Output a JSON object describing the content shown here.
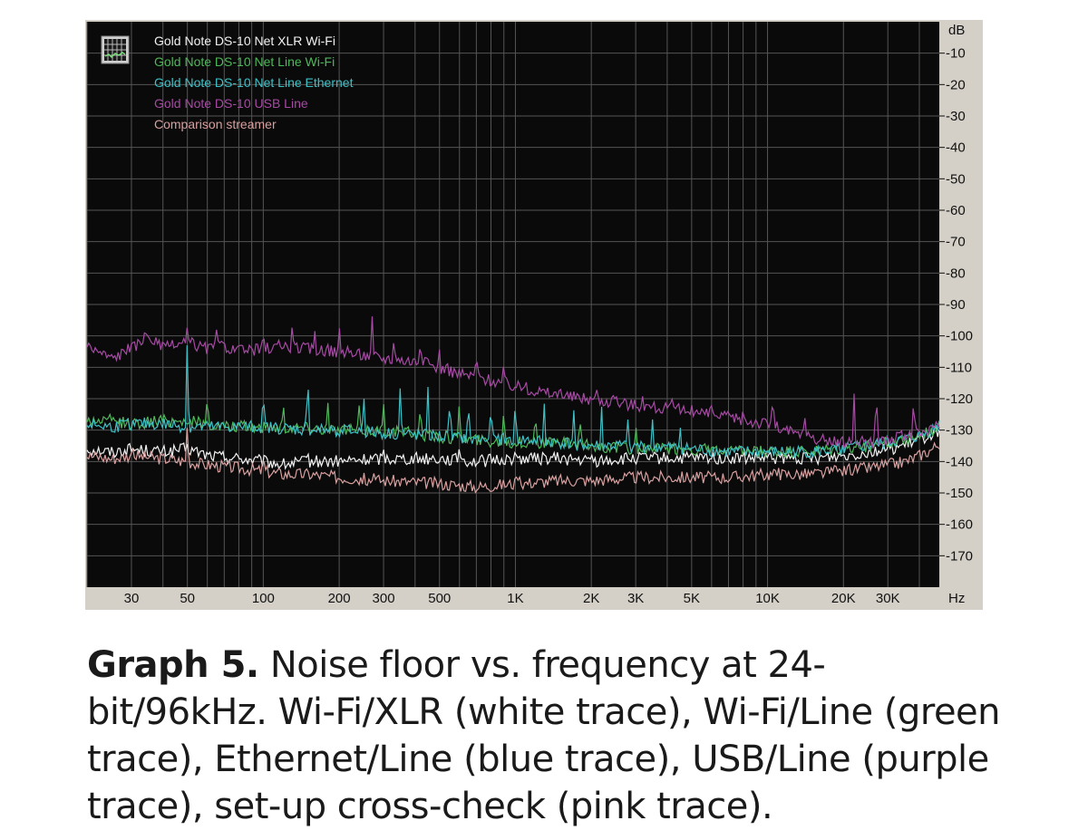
{
  "chart_data": {
    "type": "line",
    "x_scale": "log",
    "xlim": [
      20,
      48000
    ],
    "ylim": [
      -180,
      0
    ],
    "y_unit": "dB",
    "x_unit": "Hz",
    "x_ticks": [
      {
        "v": 30,
        "label": "30"
      },
      {
        "v": 50,
        "label": "50"
      },
      {
        "v": 100,
        "label": "100"
      },
      {
        "v": 200,
        "label": "200"
      },
      {
        "v": 300,
        "label": "300"
      },
      {
        "v": 500,
        "label": "500"
      },
      {
        "v": 1000,
        "label": "1K"
      },
      {
        "v": 2000,
        "label": "2K"
      },
      {
        "v": 3000,
        "label": "3K"
      },
      {
        "v": 5000,
        "label": "5K"
      },
      {
        "v": 10000,
        "label": "10K"
      },
      {
        "v": 20000,
        "label": "20K"
      },
      {
        "v": 30000,
        "label": "30K"
      }
    ],
    "y_ticks": [
      {
        "v": -10,
        "label": "-10"
      },
      {
        "v": -20,
        "label": "-20"
      },
      {
        "v": -30,
        "label": "-30"
      },
      {
        "v": -40,
        "label": "-40"
      },
      {
        "v": -50,
        "label": "-50"
      },
      {
        "v": -60,
        "label": "-60"
      },
      {
        "v": -70,
        "label": "-70"
      },
      {
        "v": -80,
        "label": "-80"
      },
      {
        "v": -90,
        "label": "-90"
      },
      {
        "v": -100,
        "label": "-100"
      },
      {
        "v": -110,
        "label": "-110"
      },
      {
        "v": -120,
        "label": "-120"
      },
      {
        "v": -130,
        "label": "-130"
      },
      {
        "v": -140,
        "label": "-140"
      },
      {
        "v": -150,
        "label": "-150"
      },
      {
        "v": -160,
        "label": "-160"
      },
      {
        "v": -170,
        "label": "-170"
      }
    ],
    "grid": true,
    "legend_position": "top-left",
    "colors": {
      "background": "#0a0a0a",
      "grid": "#555555",
      "axis_panel": "#d4d0c8"
    },
    "series": [
      {
        "name": "Gold Note DS-10 Net XLR Wi-Fi",
        "color": "#f2f2f2",
        "points": [
          [
            20,
            -136
          ],
          [
            25,
            -137
          ],
          [
            30,
            -136
          ],
          [
            40,
            -137
          ],
          [
            50,
            -136
          ],
          [
            60,
            -138
          ],
          [
            80,
            -139
          ],
          [
            100,
            -140
          ],
          [
            120,
            -141
          ],
          [
            150,
            -140
          ],
          [
            200,
            -140
          ],
          [
            300,
            -139
          ],
          [
            500,
            -139
          ],
          [
            700,
            -140
          ],
          [
            1000,
            -139
          ],
          [
            1500,
            -139
          ],
          [
            2000,
            -140
          ],
          [
            3000,
            -139
          ],
          [
            5000,
            -139
          ],
          [
            7000,
            -139
          ],
          [
            10000,
            -139
          ],
          [
            15000,
            -139
          ],
          [
            20000,
            -138
          ],
          [
            25000,
            -137
          ],
          [
            30000,
            -136
          ],
          [
            35000,
            -135
          ],
          [
            40000,
            -133
          ],
          [
            45000,
            -131
          ],
          [
            48000,
            -130
          ]
        ],
        "spikes": [
          [
            150,
            -136
          ],
          [
            300,
            -136
          ],
          [
            600,
            -135
          ],
          [
            1000,
            -136
          ],
          [
            2000,
            -137
          ],
          [
            5000,
            -137
          ]
        ]
      },
      {
        "name": "Gold Note DS-10 Net Line Wi-Fi",
        "color": "#4fb85a",
        "points": [
          [
            20,
            -127
          ],
          [
            25,
            -127
          ],
          [
            30,
            -128
          ],
          [
            40,
            -127
          ],
          [
            50,
            -127
          ],
          [
            60,
            -128
          ],
          [
            70,
            -129
          ],
          [
            100,
            -129
          ],
          [
            150,
            -129
          ],
          [
            200,
            -130
          ],
          [
            300,
            -130
          ],
          [
            500,
            -132
          ],
          [
            700,
            -133
          ],
          [
            1000,
            -134
          ],
          [
            1500,
            -134
          ],
          [
            2000,
            -135
          ],
          [
            3000,
            -136
          ],
          [
            5000,
            -136
          ],
          [
            7000,
            -137
          ],
          [
            10000,
            -137
          ],
          [
            15000,
            -137
          ],
          [
            20000,
            -136
          ],
          [
            25000,
            -135
          ],
          [
            30000,
            -134
          ],
          [
            40000,
            -132
          ],
          [
            45000,
            -130
          ],
          [
            48000,
            -128
          ]
        ],
        "spikes": [
          [
            60,
            -117
          ],
          [
            120,
            -120
          ],
          [
            180,
            -119
          ],
          [
            240,
            -122
          ],
          [
            300,
            -121
          ],
          [
            420,
            -120
          ],
          [
            600,
            -119
          ],
          [
            900,
            -121
          ],
          [
            1200,
            -122
          ],
          [
            1800,
            -124
          ],
          [
            3000,
            -127
          ]
        ]
      },
      {
        "name": "Gold Note DS-10 Net Line Ethernet",
        "color": "#3ec0c6",
        "points": [
          [
            20,
            -128
          ],
          [
            25,
            -129
          ],
          [
            30,
            -128
          ],
          [
            40,
            -128
          ],
          [
            50,
            -129
          ],
          [
            60,
            -129
          ],
          [
            70,
            -129
          ],
          [
            100,
            -129
          ],
          [
            150,
            -130
          ],
          [
            200,
            -130
          ],
          [
            300,
            -131
          ],
          [
            500,
            -132
          ],
          [
            700,
            -133
          ],
          [
            1000,
            -133
          ],
          [
            1500,
            -134
          ],
          [
            2000,
            -135
          ],
          [
            3000,
            -135
          ],
          [
            5000,
            -136
          ],
          [
            7000,
            -137
          ],
          [
            10000,
            -137
          ],
          [
            15000,
            -137
          ],
          [
            20000,
            -136
          ],
          [
            25000,
            -135
          ],
          [
            30000,
            -134
          ],
          [
            40000,
            -132
          ],
          [
            45000,
            -130
          ],
          [
            48000,
            -128
          ]
        ],
        "spikes": [
          [
            50,
            -95
          ],
          [
            100,
            -115
          ],
          [
            150,
            -108
          ],
          [
            250,
            -116
          ],
          [
            350,
            -112
          ],
          [
            450,
            -116
          ],
          [
            550,
            -117
          ],
          [
            650,
            -118
          ],
          [
            800,
            -119
          ],
          [
            1000,
            -118
          ],
          [
            1300,
            -120
          ],
          [
            1700,
            -121
          ],
          [
            2200,
            -122
          ],
          [
            2800,
            -125
          ],
          [
            3500,
            -126
          ],
          [
            4500,
            -128
          ]
        ]
      },
      {
        "name": "Gold Note DS-10 USB Line",
        "color": "#a64aa4",
        "points": [
          [
            20,
            -103
          ],
          [
            25,
            -107
          ],
          [
            30,
            -104
          ],
          [
            35,
            -100
          ],
          [
            40,
            -104
          ],
          [
            50,
            -102
          ],
          [
            60,
            -104
          ],
          [
            70,
            -103
          ],
          [
            80,
            -105
          ],
          [
            100,
            -104
          ],
          [
            120,
            -103
          ],
          [
            150,
            -104
          ],
          [
            200,
            -105
          ],
          [
            250,
            -106
          ],
          [
            300,
            -107
          ],
          [
            400,
            -108
          ],
          [
            500,
            -110
          ],
          [
            600,
            -112
          ],
          [
            800,
            -114
          ],
          [
            1000,
            -116
          ],
          [
            1500,
            -119
          ],
          [
            2000,
            -120
          ],
          [
            3000,
            -122
          ],
          [
            5000,
            -124
          ],
          [
            7000,
            -126
          ],
          [
            10000,
            -128
          ],
          [
            15000,
            -133
          ],
          [
            20000,
            -134
          ],
          [
            25000,
            -134
          ],
          [
            30000,
            -133
          ],
          [
            40000,
            -131
          ],
          [
            48000,
            -129
          ]
        ],
        "spikes": [
          [
            50,
            -96
          ],
          [
            65,
            -96
          ],
          [
            100,
            -98
          ],
          [
            130,
            -97
          ],
          [
            160,
            -98
          ],
          [
            200,
            -96
          ],
          [
            270,
            -92
          ],
          [
            330,
            -100
          ],
          [
            420,
            -101
          ],
          [
            500,
            -104
          ],
          [
            700,
            -104
          ],
          [
            900,
            -107
          ],
          [
            1100,
            -114
          ],
          [
            1500,
            -116
          ],
          [
            2100,
            -117
          ],
          [
            2500,
            -118
          ],
          [
            3200,
            -119
          ],
          [
            4200,
            -119
          ],
          [
            6000,
            -122
          ],
          [
            8000,
            -123
          ],
          [
            10500,
            -117
          ],
          [
            14000,
            -123
          ],
          [
            22000,
            -116
          ],
          [
            27000,
            -113
          ],
          [
            38000,
            -117
          ]
        ]
      },
      {
        "name": "Comparison streamer",
        "color": "#d9a0a0",
        "points": [
          [
            20,
            -138
          ],
          [
            25,
            -139
          ],
          [
            30,
            -138
          ],
          [
            40,
            -139
          ],
          [
            50,
            -140
          ],
          [
            60,
            -141
          ],
          [
            80,
            -142
          ],
          [
            100,
            -143
          ],
          [
            120,
            -144
          ],
          [
            150,
            -144
          ],
          [
            200,
            -145
          ],
          [
            300,
            -146
          ],
          [
            500,
            -147
          ],
          [
            700,
            -148
          ],
          [
            1000,
            -147
          ],
          [
            1500,
            -146
          ],
          [
            2000,
            -146
          ],
          [
            3000,
            -145
          ],
          [
            5000,
            -145
          ],
          [
            7000,
            -145
          ],
          [
            10000,
            -144
          ],
          [
            15000,
            -144
          ],
          [
            20000,
            -143
          ],
          [
            25000,
            -142
          ],
          [
            30000,
            -141
          ],
          [
            35000,
            -140
          ],
          [
            40000,
            -138
          ],
          [
            45000,
            -136
          ],
          [
            48000,
            -134
          ]
        ],
        "spikes": [
          [
            50,
            -126
          ],
          [
            100,
            -137
          ],
          [
            1000,
            -151
          ]
        ]
      }
    ]
  },
  "axis": {
    "y_unit_label": "dB",
    "x_unit_label": "Hz"
  },
  "caption": {
    "bold": "Graph 5.",
    "text": "Noise floor vs. frequency at 24-bit/96kHz. Wi-Fi/XLR (white trace), Wi-Fi/Line (green trace), Ethernet/Line (blue trace), USB/Line (purple trace), set-up cross-check (pink trace)."
  }
}
